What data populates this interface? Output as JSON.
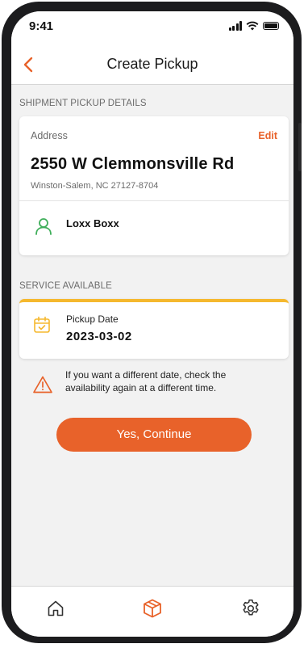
{
  "status_bar": {
    "time": "9:41",
    "signal_icon": "signal-icon",
    "wifi_icon": "wifi-icon",
    "battery_icon": "battery-icon"
  },
  "header": {
    "title": "Create Pickup",
    "back_icon": "chevron-left-icon"
  },
  "pickup_details": {
    "section_label": "SHIPMENT PICKUP DETAILS",
    "address_label": "Address",
    "edit_label": "Edit",
    "street": "2550 W Clemmonsville Rd",
    "city_line": "Winston-Salem, NC 27127-8704",
    "contact_name": "Loxx Boxx",
    "contact_icon": "user-icon"
  },
  "service": {
    "section_label": "SERVICE AVAILABLE",
    "pickup_date_label": "Pickup Date",
    "pickup_date_value": "2023-03-02",
    "calendar_icon": "calendar-check-icon"
  },
  "warning": {
    "icon": "warning-triangle-icon",
    "text": "If you want a different date, check the availability again at a different time."
  },
  "primary_action": {
    "label": "Yes, Continue"
  },
  "tab_bar": {
    "items": [
      {
        "icon": "home-icon",
        "active": false
      },
      {
        "icon": "package-icon",
        "active": true
      },
      {
        "icon": "gear-icon",
        "active": false
      }
    ]
  },
  "colors": {
    "accent": "#e8622a",
    "service_highlight": "#f5b82e",
    "contact_icon": "#3fae5a",
    "background": "#f2f2f2"
  }
}
